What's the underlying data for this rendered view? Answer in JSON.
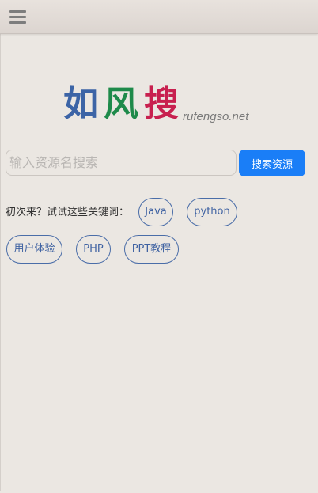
{
  "header": {
    "menu_icon": "hamburger-menu-icon"
  },
  "logo": {
    "char1": "如",
    "char2": "风",
    "char3": "搜",
    "domain": "rufengso.net",
    "colors": {
      "char1": "#3c64a6",
      "char2": "#1e8a4a",
      "char3": "#c8204f"
    }
  },
  "search": {
    "placeholder": "输入资源名搜索",
    "value": "",
    "button_label": "搜索资源",
    "button_color": "#1a7ef7"
  },
  "suggestions": {
    "hint": "初次来？试试这些关键词：",
    "tags": [
      "Java",
      "python",
      "用户体验",
      "PHP",
      "PPT教程"
    ]
  }
}
